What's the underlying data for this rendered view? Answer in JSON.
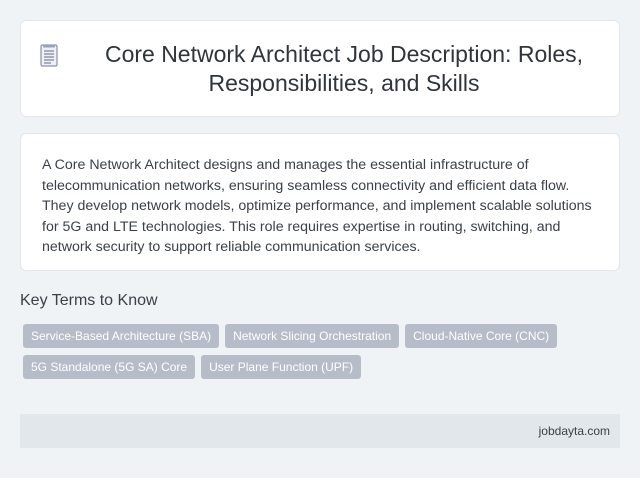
{
  "header": {
    "icon": "document-icon",
    "title": "Core Network Architect Job Description: Roles, Responsibilities, and Skills"
  },
  "description": "A Core Network Architect designs and manages the essential infrastructure of telecommunication networks, ensuring seamless connectivity and efficient data flow. They develop network models, optimize performance, and implement scalable solutions for 5G and LTE technologies. This role requires expertise in routing, switching, and network security to support reliable communication services.",
  "key_terms": {
    "heading": "Key Terms to Know",
    "items": [
      "Service-Based Architecture (SBA)",
      "Network Slicing Orchestration",
      "Cloud-Native Core (CNC)",
      "5G Standalone (5G SA) Core",
      "User Plane Function (UPF)"
    ]
  },
  "footer": {
    "brand": "jobdayta.com"
  }
}
